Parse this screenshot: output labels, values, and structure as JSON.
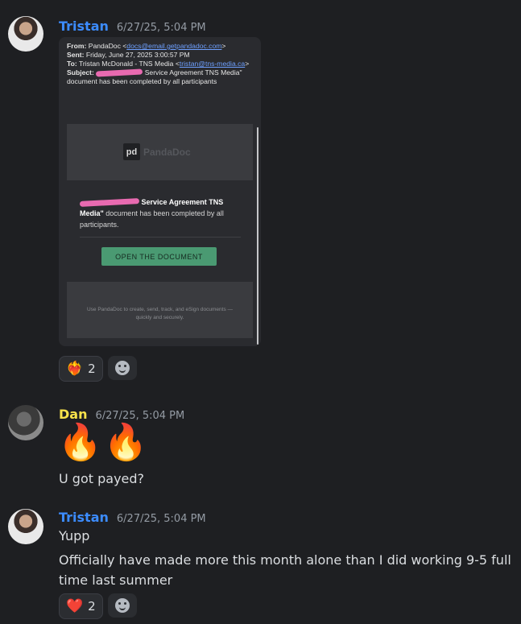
{
  "messages": [
    {
      "author": "Tristan",
      "time": "6/27/25, 5:04 PM",
      "email": {
        "from_label": "From:",
        "from_value": "PandaDoc <",
        "from_link": "docs@email.getpandadoc.com",
        "from_end": ">",
        "sent_label": "Sent:",
        "sent_value": "Friday, June 27, 2025 3:00:57 PM",
        "to_label": "To:",
        "to_value": "Tristan McDonald - TNS Media <",
        "to_link": "tristan@tns-media.ca",
        "to_end": ">",
        "subject_label": "Subject:",
        "subject_value": "Service Agreement TNS Media\" document has been completed by all participants",
        "logo_glyph": "pd",
        "logo_word": "PandaDoc",
        "notice_bold": "Service Agreement TNS Media\"",
        "notice_rest": "document has been completed by all participants.",
        "button_label": "OPEN THE DOCUMENT",
        "footer_text": "Use PandaDoc to create, send, track, and eSign documents — quickly and securely."
      },
      "reactions": [
        {
          "emoji": "❤️‍🔥",
          "count": "2"
        }
      ]
    },
    {
      "author": "Dan",
      "time": "6/27/25, 5:04 PM",
      "emoji_line": "🔥🔥",
      "text": "U got payed?"
    },
    {
      "author": "Tristan",
      "time": "6/27/25, 5:04 PM",
      "line1": "Yupp",
      "line2": "Officially have made more this month alone than I did working 9-5 full time last summer",
      "reactions": [
        {
          "emoji": "❤️",
          "count": "2"
        }
      ]
    }
  ],
  "icons": {
    "add_reaction": "smile-icon"
  },
  "colors": {
    "tristan": "#3c8cff",
    "dan": "#f7e24b",
    "background": "#1e1f22",
    "button": "#4a9a72"
  }
}
